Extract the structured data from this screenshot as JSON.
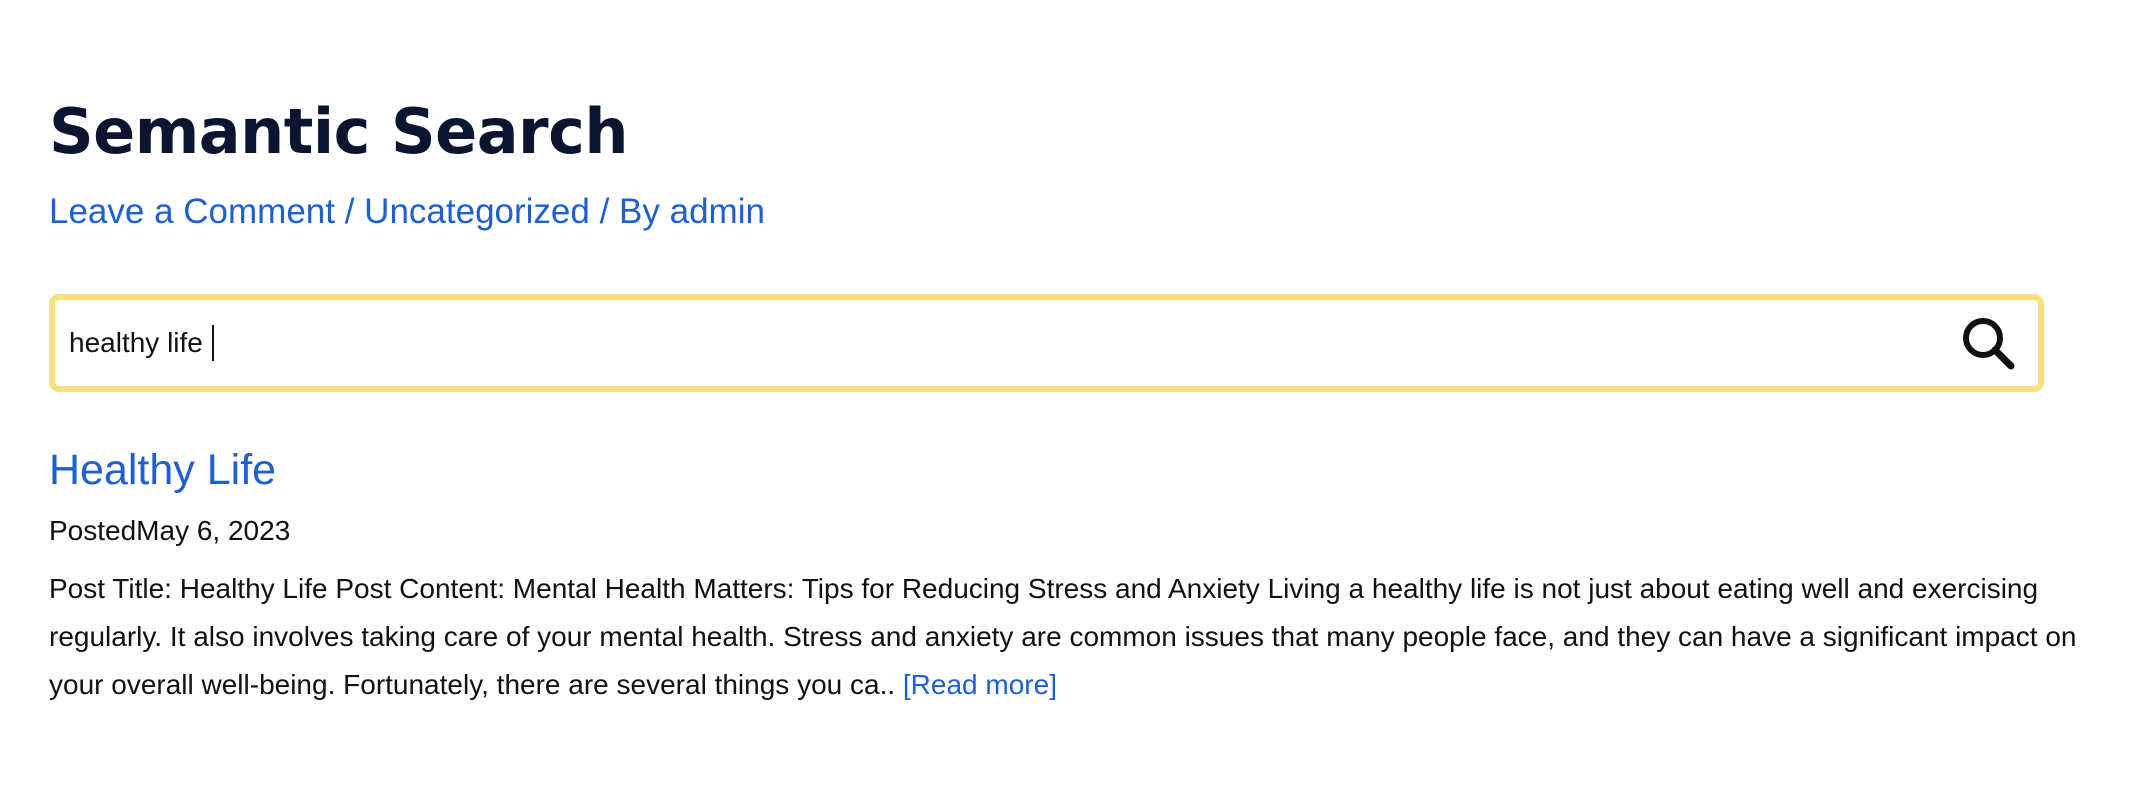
{
  "page": {
    "title": "Semantic Search"
  },
  "meta": {
    "comment_link": "Leave a Comment",
    "separator_1": " / ",
    "category_link": "Uncategorized",
    "separator_2": " / By ",
    "author_link": "admin"
  },
  "search": {
    "value": "healthy life",
    "icon": "search-icon",
    "border_color": "#f6e17e"
  },
  "result": {
    "title": "Healthy Life",
    "posted_prefix": "Posted",
    "posted_date": "May 6, 2023",
    "excerpt_lines": [
      "Post Title: Healthy Life Post Content: Mental Health Matters: Tips for Reducing Stress and Anxiety Living a healthy life is not just about eating well and exercising",
      "regularly. It also involves taking care of your mental health. Stress and anxiety are common issues that many people face, and they can have a significant impact on",
      "your overall well-being. Fortunately, there are several things you ca.. "
    ],
    "read_more": "[Read more]"
  },
  "colors": {
    "link": "#1e5fd1",
    "title": "#0b1530"
  }
}
